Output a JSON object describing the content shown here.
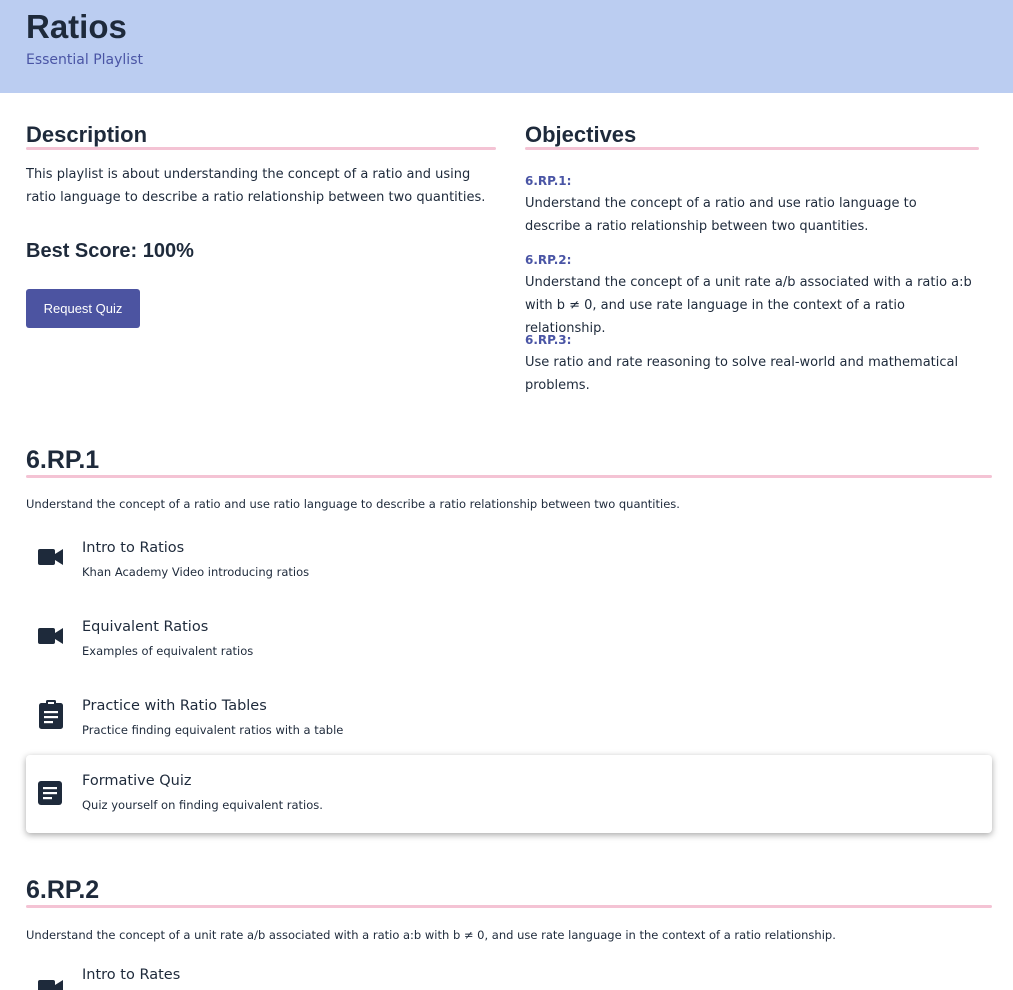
{
  "header": {
    "title": "Ratios",
    "subtitle": "Essential Playlist"
  },
  "description": {
    "heading": "Description",
    "text": "This playlist is about understanding the concept of a ratio and using ratio language to describe a ratio relationship between two quantities."
  },
  "best_score": "Best Score: 100%",
  "request_quiz_label": "Request Quiz",
  "objectives": {
    "heading": "Objectives",
    "items": [
      {
        "code": "6.RP.1:",
        "text": "Understand the concept of a ratio and use ratio language to describe a ratio relationship between two quantities."
      },
      {
        "code": "6.RP.2:",
        "text": "Understand the concept of a unit rate a/b associated with a ratio a:b with b ≠ 0, and use rate language in the context of a ratio relationship."
      },
      {
        "code": "6.RP.3:",
        "text": "Use ratio and rate reasoning to solve real-world and mathematical problems."
      }
    ]
  },
  "sections": [
    {
      "title": "6.RP.1",
      "description": "Understand the concept of a ratio and use ratio language to describe a ratio relationship between two quantities.",
      "items": [
        {
          "icon": "video-camera-icon",
          "title": "Intro to Ratios",
          "subtitle": "Khan Academy Video introducing ratios"
        },
        {
          "icon": "video-camera-icon",
          "title": "Equivalent Ratios",
          "subtitle": "Examples of equivalent ratios"
        },
        {
          "icon": "clipboard-icon",
          "title": "Practice with Ratio Tables",
          "subtitle": "Practice finding equivalent ratios with a table"
        },
        {
          "icon": "document-icon",
          "title": "Formative Quiz",
          "subtitle": "Quiz yourself on finding equivalent ratios."
        }
      ]
    },
    {
      "title": "6.RP.2",
      "description": "Understand the concept of a unit rate a/b associated with a ratio a:b with b ≠ 0, and use rate language in the context of a ratio relationship.",
      "items": [
        {
          "icon": "video-camera-icon",
          "title": "Intro to Rates",
          "subtitle": ""
        }
      ]
    }
  ],
  "colors": {
    "header_bg": "#bbcdf1",
    "accent": "#4c54a1",
    "rule": "#f4c3d4",
    "text": "#1e2a3b"
  }
}
